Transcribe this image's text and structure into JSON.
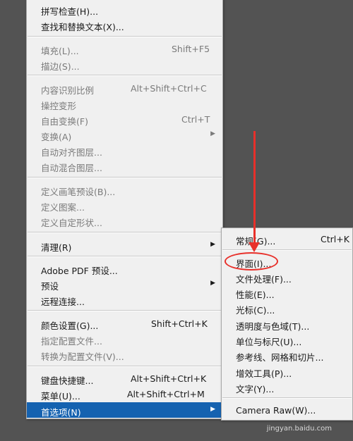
{
  "main_menu": {
    "items": [
      {
        "label": "拼写检查(H)...",
        "shortcut": "",
        "disabled": false,
        "arrow": false
      },
      {
        "label": "查找和替换文本(X)...",
        "shortcut": "",
        "disabled": false,
        "arrow": false
      },
      {
        "label": "填充(L)...",
        "shortcut": "Shift+F5",
        "disabled": true,
        "arrow": false
      },
      {
        "label": "描边(S)...",
        "shortcut": "",
        "disabled": true,
        "arrow": false
      },
      {
        "label": "内容识别比例",
        "shortcut": "Alt+Shift+Ctrl+C",
        "disabled": true,
        "arrow": false
      },
      {
        "label": "操控变形",
        "shortcut": "",
        "disabled": true,
        "arrow": false
      },
      {
        "label": "自由变换(F)",
        "shortcut": "Ctrl+T",
        "disabled": true,
        "arrow": false
      },
      {
        "label": "变换(A)",
        "shortcut": "",
        "disabled": true,
        "arrow": true
      },
      {
        "label": "自动对齐图层...",
        "shortcut": "",
        "disabled": true,
        "arrow": false
      },
      {
        "label": "自动混合图层...",
        "shortcut": "",
        "disabled": true,
        "arrow": false
      },
      {
        "label": "定义画笔预设(B)...",
        "shortcut": "",
        "disabled": true,
        "arrow": false
      },
      {
        "label": "定义图案...",
        "shortcut": "",
        "disabled": true,
        "arrow": false
      },
      {
        "label": "定义自定形状...",
        "shortcut": "",
        "disabled": true,
        "arrow": false
      },
      {
        "label": "清理(R)",
        "shortcut": "",
        "disabled": false,
        "arrow": true
      },
      {
        "label": "Adobe PDF 预设...",
        "shortcut": "",
        "disabled": false,
        "arrow": false
      },
      {
        "label": "预设",
        "shortcut": "",
        "disabled": false,
        "arrow": true
      },
      {
        "label": "远程连接...",
        "shortcut": "",
        "disabled": false,
        "arrow": false
      },
      {
        "label": "颜色设置(G)...",
        "shortcut": "Shift+Ctrl+K",
        "disabled": false,
        "arrow": false
      },
      {
        "label": "指定配置文件...",
        "shortcut": "",
        "disabled": true,
        "arrow": false
      },
      {
        "label": "转换为配置文件(V)...",
        "shortcut": "",
        "disabled": true,
        "arrow": false
      },
      {
        "label": "键盘快捷键...",
        "shortcut": "Alt+Shift+Ctrl+K",
        "disabled": false,
        "arrow": false
      },
      {
        "label": "菜单(U)...",
        "shortcut": "Alt+Shift+Ctrl+M",
        "disabled": false,
        "arrow": false
      },
      {
        "label": "首选项(N)",
        "shortcut": "",
        "disabled": false,
        "arrow": true,
        "active": true
      }
    ]
  },
  "sub_menu": {
    "items": [
      {
        "label": "常规(G)...",
        "shortcut": "Ctrl+K"
      },
      {
        "label": "界面(I)...",
        "shortcut": ""
      },
      {
        "label": "文件处理(F)...",
        "shortcut": ""
      },
      {
        "label": "性能(E)...",
        "shortcut": ""
      },
      {
        "label": "光标(C)...",
        "shortcut": ""
      },
      {
        "label": "透明度与色域(T)...",
        "shortcut": ""
      },
      {
        "label": "单位与标尺(U)...",
        "shortcut": ""
      },
      {
        "label": "参考线、网格和切片...",
        "shortcut": ""
      },
      {
        "label": "增效工具(P)...",
        "shortcut": ""
      },
      {
        "label": "文字(Y)...",
        "shortcut": ""
      },
      {
        "label": "Camera Raw(W)...",
        "shortcut": ""
      }
    ]
  },
  "watermark": "jingyan.baidu.com",
  "colors": {
    "highlight": "#1562b0",
    "annotation": "#e8302a",
    "menu_bg": "#f0f0f0",
    "backdrop": "#535353"
  }
}
